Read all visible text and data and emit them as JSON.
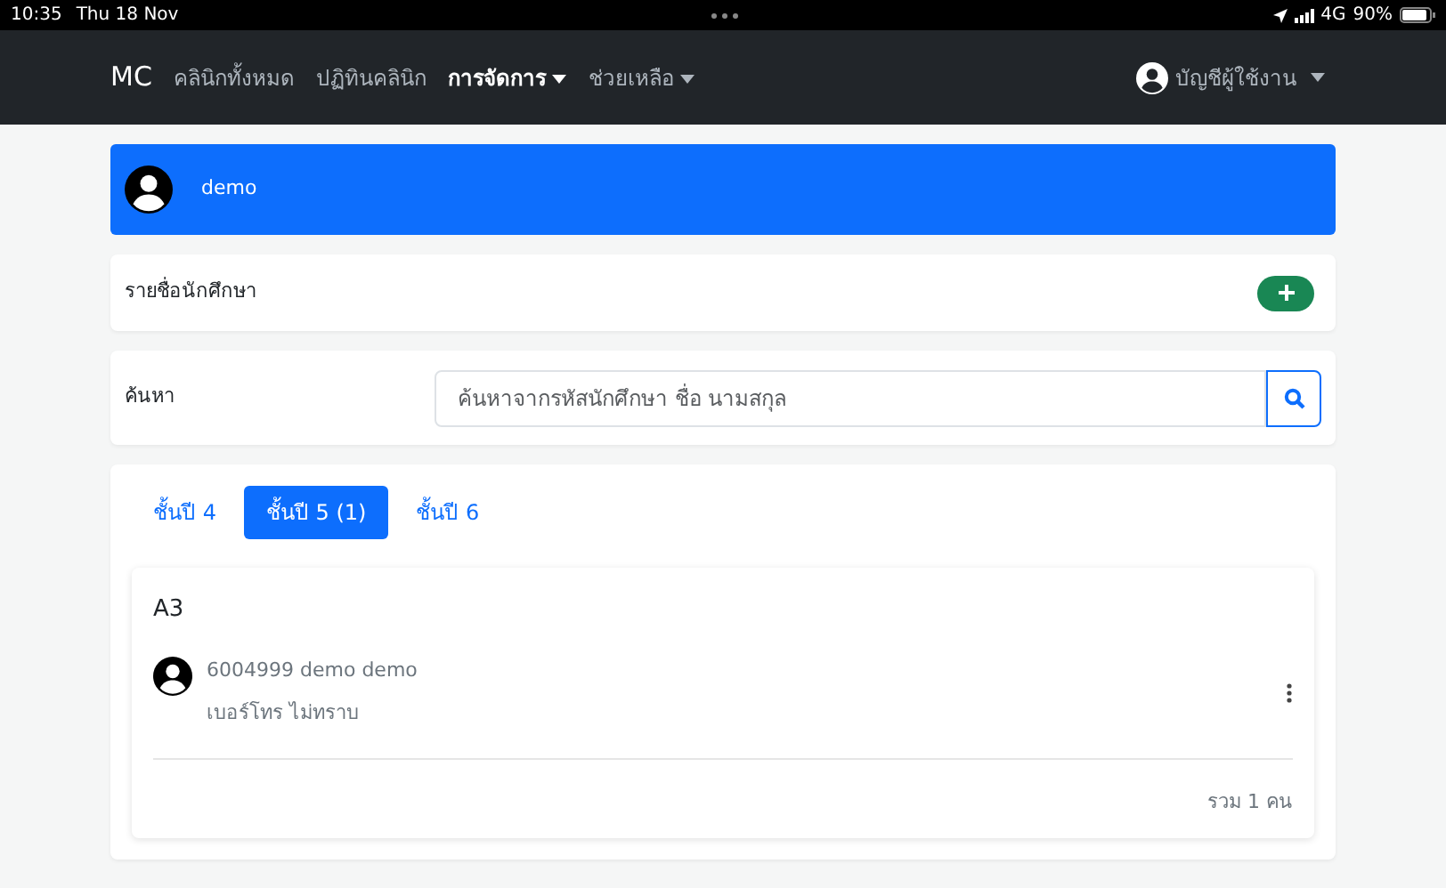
{
  "status_bar": {
    "time": "10:35",
    "date": "Thu 18 Nov",
    "network": "4G",
    "battery": "90%"
  },
  "navbar": {
    "brand": "MC",
    "items": [
      {
        "label": "คลินิกทั้งหมด",
        "dropdown": false,
        "selected": false
      },
      {
        "label": "ปฏิทินคลินิก",
        "dropdown": false,
        "selected": false
      },
      {
        "label": "การจัดการ",
        "dropdown": true,
        "selected": true
      },
      {
        "label": "ช่วยเหลือ",
        "dropdown": true,
        "selected": false
      }
    ],
    "account": {
      "label": "บัญชีผู้ใช้งาน",
      "dropdown": true
    }
  },
  "user_banner": {
    "name": "demo"
  },
  "student_list": {
    "title": "รายชื่อนักศึกษา"
  },
  "search": {
    "label": "ค้นหา",
    "placeholder": "ค้นหาจากรหัสนักศึกษา ชื่อ นามสกุล"
  },
  "tabs": [
    {
      "label": "ชั้นปี 4",
      "selected": false
    },
    {
      "label": "ชั้นปี 5 (1)",
      "selected": true
    },
    {
      "label": "ชั้นปี 6",
      "selected": false
    }
  ],
  "group": {
    "title": "A3",
    "students": [
      {
        "id": "6004999",
        "name": "demo demo",
        "phone_label": "เบอร์โทร",
        "phone": "ไม่ทราบ"
      }
    ],
    "total": "รวม 1 คน"
  }
}
